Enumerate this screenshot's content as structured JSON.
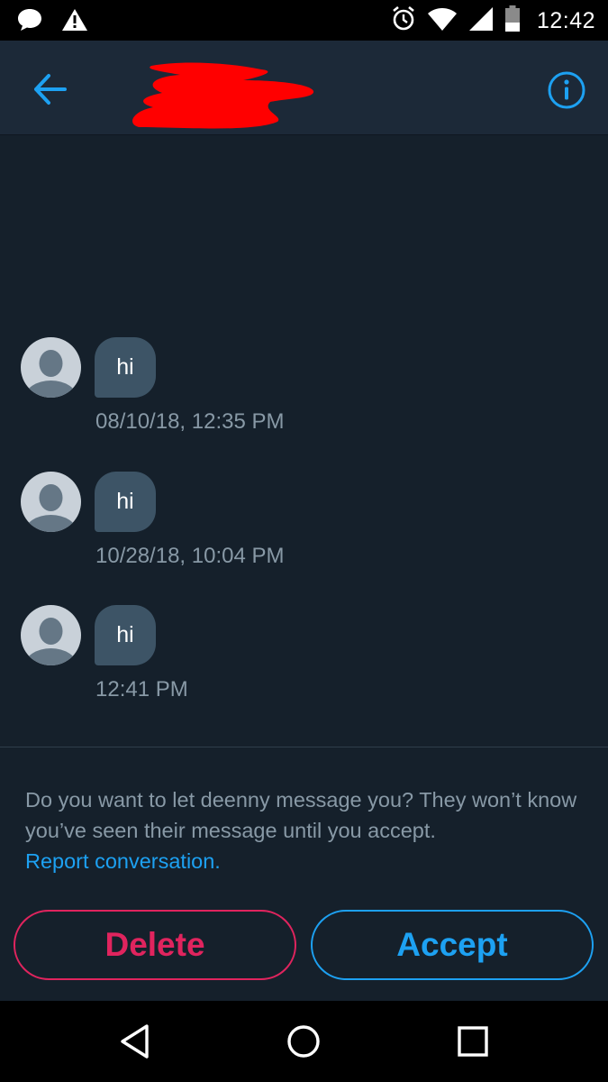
{
  "status_bar": {
    "time": "12:42",
    "left_icons": [
      "chat-bubble-icon",
      "warning-icon"
    ],
    "right_icons": [
      "alarm-icon",
      "wifi-icon",
      "cellular-signal-icon",
      "battery-icon"
    ]
  },
  "header": {
    "back_icon": "arrow-left-icon",
    "info_icon": "info-icon",
    "accent_color": "#1da1f2"
  },
  "messages": [
    {
      "text": "hi",
      "timestamp": "08/10/18, 12:35 PM"
    },
    {
      "text": "hi",
      "timestamp": "10/28/18, 10:04 PM"
    },
    {
      "text": "hi",
      "timestamp": "12:41 PM"
    }
  ],
  "request": {
    "prompt": "Do you want to let deenny message you? They won’t know you’ve seen their message until you accept.",
    "report_link": "Report conversation."
  },
  "actions": {
    "delete_label": "Delete",
    "accept_label": "Accept",
    "delete_color": "#e0245e",
    "accept_color": "#1da1f2"
  },
  "nav_bar": {
    "icons": [
      "back-triangle-icon",
      "home-circle-icon",
      "recents-square-icon"
    ]
  },
  "colors": {
    "background": "#15202b",
    "header_background": "#1c2938",
    "bubble": "#3d5466",
    "secondary_text": "#8899a6"
  }
}
